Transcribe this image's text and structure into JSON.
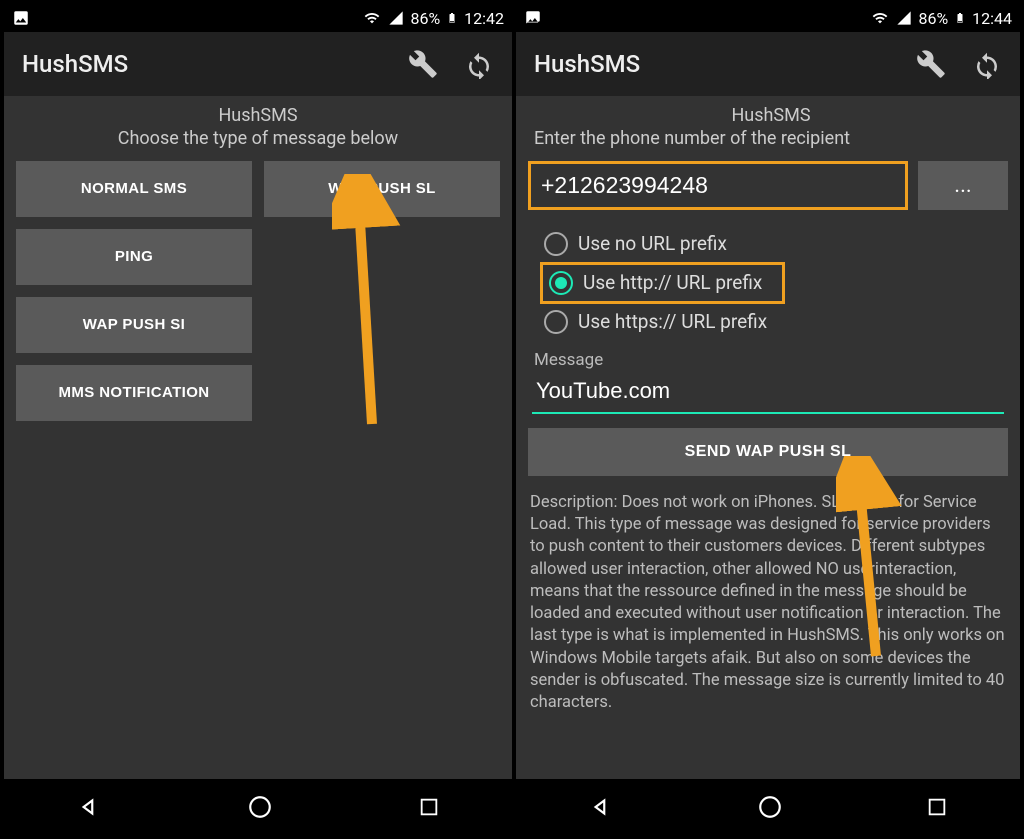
{
  "left": {
    "status": {
      "battery": "86%",
      "time": "12:42"
    },
    "app_title": "HushSMS",
    "heading_line1": "HushSMS",
    "heading_line2": "Choose the type of message below",
    "buttons": {
      "normal_sms": "NORMAL SMS",
      "wap_push_sl": "WAP PUSH SL",
      "ping": "PING",
      "wap_push_si": "WAP PUSH SI",
      "mms_notification": "MMS NOTIFICATION"
    }
  },
  "right": {
    "status": {
      "battery": "86%",
      "time": "12:44"
    },
    "app_title": "HushSMS",
    "heading_line1": "HushSMS",
    "heading_line2": "Enter the phone number of the recipient",
    "phone_value": "+212623994248",
    "contacts_btn": "...",
    "radios": {
      "none": "Use no URL prefix",
      "http": "Use http:// URL prefix",
      "https": "Use https:// URL prefix"
    },
    "message_label": "Message",
    "message_value": "YouTube.com",
    "send_label": "SEND WAP PUSH SL",
    "description": "Description: Does not work on iPhones. SL stands for Service Load. This type of message was designed for service providers to push content to their customers devices. Different subtypes allowed user interaction, other allowed NO userinteraction, means that the ressource defined in the message should be loaded and executed without user notification or interaction. The last type is what is implemented in HushSMS. This only works on Windows Mobile targets afaik. But also on some devices the sender is obfuscated. The message size is currently limited to 40 characters."
  }
}
